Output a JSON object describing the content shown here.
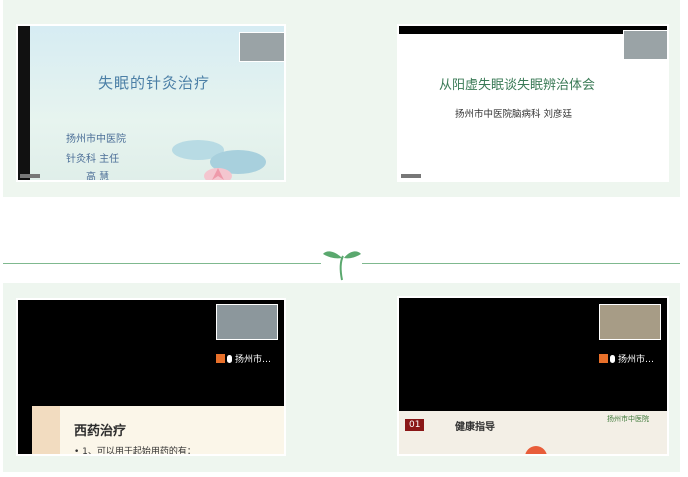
{
  "slides": {
    "slide1": {
      "title": "失眠的针灸治疗",
      "lines": [
        "扬州市中医院",
        "针灸科 主任",
        "高 慧"
      ]
    },
    "slide2": {
      "title": "从阳虚失眠谈失眠辨治体会",
      "subtitle": "扬州市中医院脑病科  刘彦廷"
    },
    "slide3": {
      "cam_label": "扬州市…",
      "heading": "西药治疗",
      "bullet": "• 1、可以用于起始用药的有："
    },
    "slide4": {
      "cam_label": "扬州市…",
      "num": "01",
      "heading": "健康指导",
      "logo": "扬州市中医院"
    }
  },
  "colors": {
    "panel": "#eef6ef",
    "divider": "#7fb98f",
    "accent": "#e8702a"
  }
}
